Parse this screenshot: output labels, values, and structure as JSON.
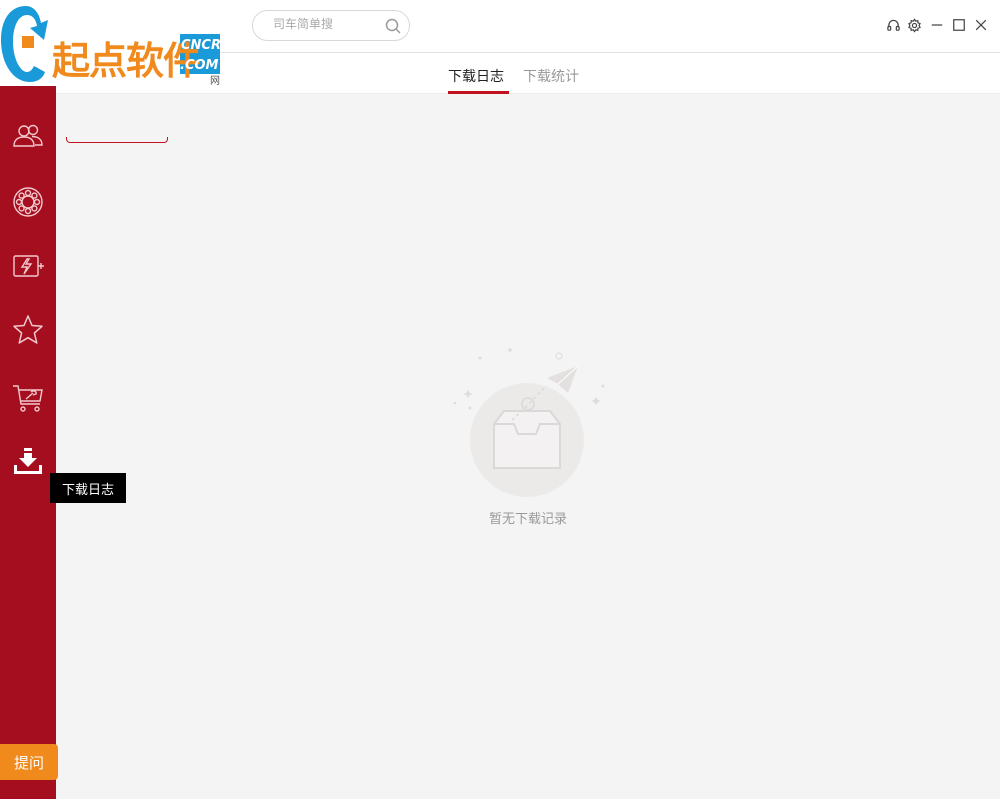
{
  "logo": {
    "cn_text": "起点软件",
    "badge_top": "CNCRK",
    "badge_bottom": ".COM"
  },
  "search": {
    "placeholder": "司车简单搜"
  },
  "tabs": [
    {
      "label": "下载日志",
      "active": true
    },
    {
      "label": "下载统计",
      "active": false
    }
  ],
  "sidebar": {
    "items": [
      {
        "icon": "users-icon"
      },
      {
        "icon": "gear-wheel-icon"
      },
      {
        "icon": "tablet-flash-icon"
      },
      {
        "icon": "star-icon"
      },
      {
        "icon": "cart-tools-icon"
      },
      {
        "icon": "download-icon",
        "active": true
      }
    ],
    "tooltip": "下载日志"
  },
  "empty_state": {
    "text": "暂无下载记录"
  },
  "ask_button": {
    "label": "提问"
  },
  "window_controls": [
    "headset-icon",
    "settings-icon",
    "minimize-icon",
    "maximize-icon",
    "close-icon"
  ],
  "colors": {
    "sidebar": "#a50e1f",
    "accent": "#c1121f",
    "ask_button": "#f08a1d",
    "logo_orange": "#f08a1d",
    "logo_blue": "#1a9ad9"
  }
}
